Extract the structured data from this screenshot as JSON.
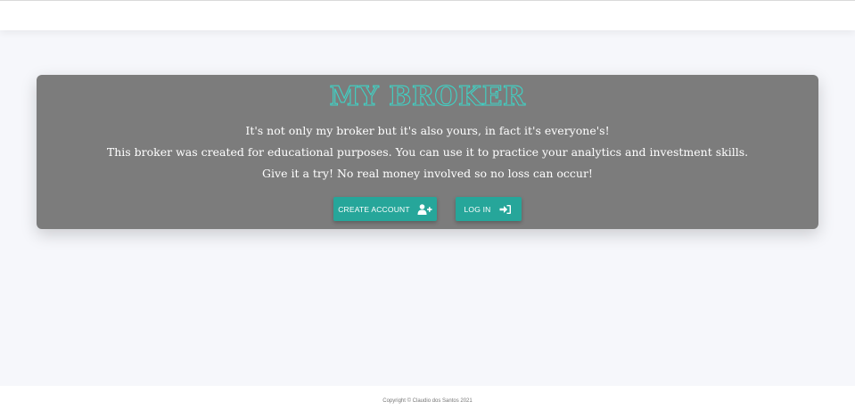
{
  "hero": {
    "title": "MY BROKER",
    "line1": "It's not only my broker but it's also yours, in fact it's everyone's!",
    "line2": "This broker was created for educational purposes. You can use it to practice your analytics and investment skills.",
    "line3": "Give it a try! No real money involved so no loss can occur!",
    "create_account_label": "CREATE ACCOUNT",
    "create_account_icon": "user-plus-icon",
    "login_label": "LOG IN",
    "login_icon": "sign-in-icon"
  },
  "footer": {
    "copyright": "Copyright © Claudio dos Santos 2021"
  },
  "colors": {
    "accent": "#26a69a",
    "title_outline": "#3fd3c6",
    "hero_background": "#7c7c7c",
    "page_background": "#f6f7fb"
  }
}
